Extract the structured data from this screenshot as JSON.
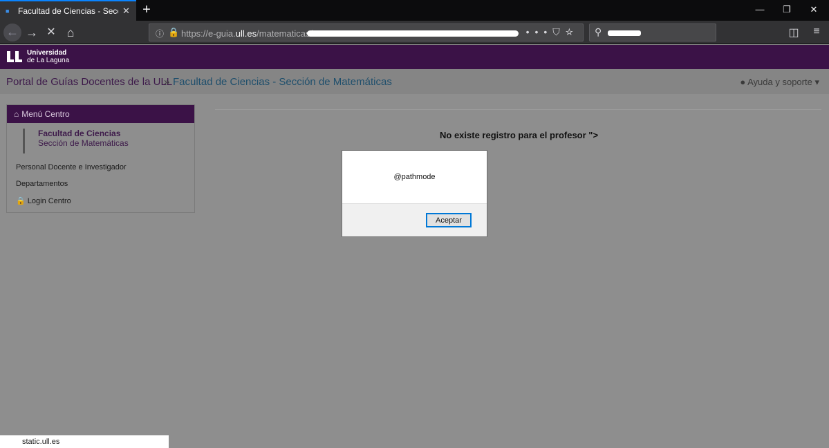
{
  "browser": {
    "tab_title": "Facultad de Ciencias - Sección",
    "tab_close": "✕",
    "new_tab": "+",
    "url_prefix": "https://e-guia.",
    "url_domain": "ull.es",
    "url_path": "/matematicas/",
    "window_minimize": "—",
    "window_restore": "❐",
    "window_close": "✕"
  },
  "site": {
    "logo_line1": "Universidad",
    "logo_line2": "de La Laguna",
    "brand_color": "#3b1247"
  },
  "breadcrumb": {
    "portal": "Portal de Guías Docentes de la ULL",
    "separator": "»",
    "section": "Facultad de Ciencias - Sección de Matemáticas",
    "help": "Ayuda y soporte"
  },
  "sidemenu": {
    "title": "Menú Centro",
    "brand_line1": "Facultad de Ciencias",
    "brand_line2": "Sección de Matemáticas",
    "links": [
      "Personal Docente e Investigador",
      "Departamentos",
      "Login Centro"
    ]
  },
  "main": {
    "message": "No existe registro para el profesor \">"
  },
  "dialog": {
    "message": "@pathmode",
    "ok_label": "Aceptar"
  },
  "status": {
    "text": "static.ull.es"
  }
}
